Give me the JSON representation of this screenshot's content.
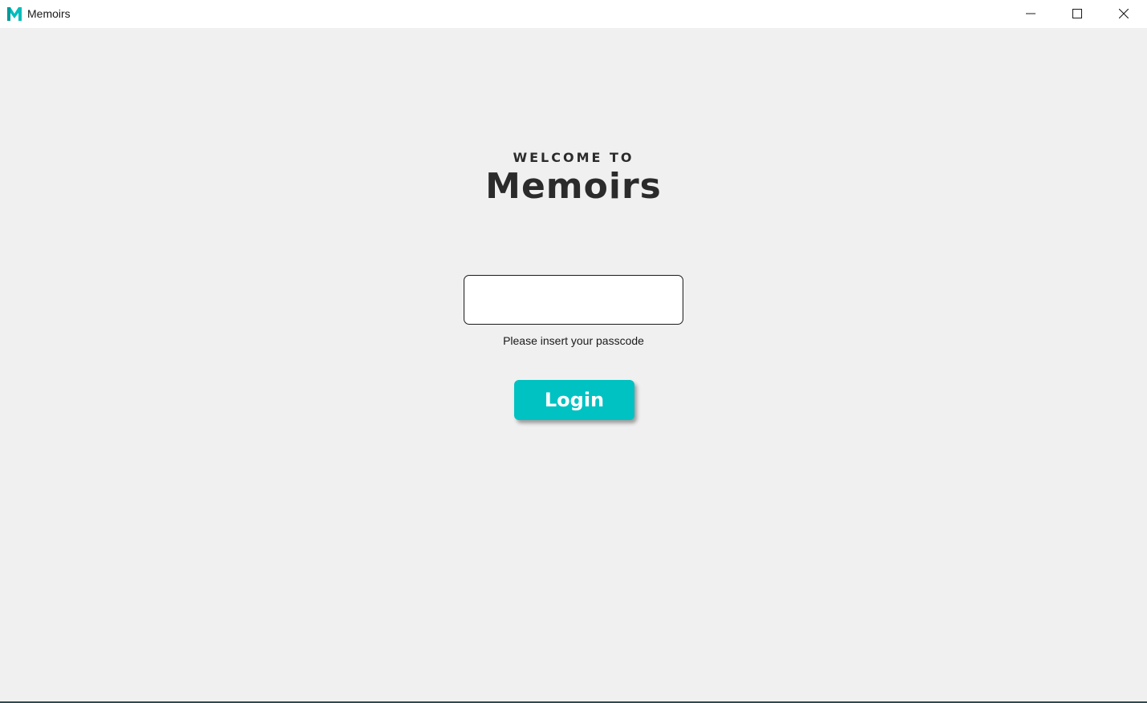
{
  "window": {
    "title": "Memoirs",
    "logo_icon": "memoirs-m-logo-icon",
    "accent_color": "#00c2c2",
    "controls": {
      "minimize_icon": "minimize-icon",
      "maximize_icon": "maximize-icon",
      "close_icon": "close-icon"
    }
  },
  "login": {
    "welcome_label": "WELCOME TO",
    "app_name": "Memoirs",
    "passcode_value": "",
    "passcode_placeholder": "",
    "passcode_hint": "Please insert your passcode",
    "login_label": "Login"
  }
}
